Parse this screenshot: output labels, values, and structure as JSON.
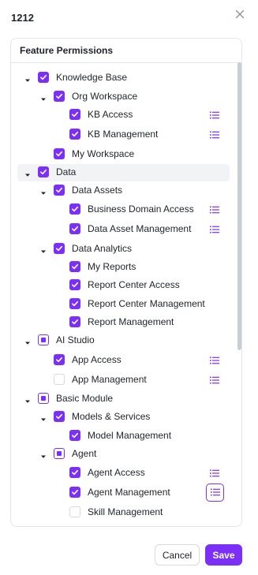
{
  "modal": {
    "title": "1212",
    "close_icon": "close-icon"
  },
  "panel": {
    "title": "Feature Permissions"
  },
  "tree": [
    {
      "label": "Knowledge Base",
      "level": 0,
      "state": "checked",
      "caret": true,
      "list": false
    },
    {
      "label": "Org Workspace",
      "level": 1,
      "state": "checked",
      "caret": true,
      "list": false
    },
    {
      "label": "KB Access",
      "level": 2,
      "state": "checked",
      "caret": false,
      "list": true
    },
    {
      "label": "KB Management",
      "level": 2,
      "state": "checked",
      "caret": false,
      "list": true
    },
    {
      "label": "My Workspace",
      "level": 1,
      "state": "checked",
      "caret": false,
      "list": false
    },
    {
      "label": "Data",
      "level": 0,
      "state": "checked",
      "caret": true,
      "list": false,
      "highlight": true
    },
    {
      "label": "Data Assets",
      "level": 1,
      "state": "checked",
      "caret": true,
      "list": false
    },
    {
      "label": "Business Domain Access",
      "level": 2,
      "state": "checked",
      "caret": false,
      "list": true
    },
    {
      "label": "Data Asset Management",
      "level": 2,
      "state": "checked",
      "caret": false,
      "list": true
    },
    {
      "label": "Data Analytics",
      "level": 1,
      "state": "checked",
      "caret": true,
      "list": false
    },
    {
      "label": "My Reports",
      "level": 2,
      "state": "checked",
      "caret": false,
      "list": false
    },
    {
      "label": "Report Center Access",
      "level": 2,
      "state": "checked",
      "caret": false,
      "list": false
    },
    {
      "label": "Report Center Management",
      "level": 2,
      "state": "checked",
      "caret": false,
      "list": false
    },
    {
      "label": "Report Management",
      "level": 2,
      "state": "checked",
      "caret": false,
      "list": false
    },
    {
      "label": "AI Studio",
      "level": 0,
      "state": "partial",
      "caret": true,
      "list": false
    },
    {
      "label": "App Access",
      "level": 1,
      "state": "checked",
      "caret": false,
      "list": true
    },
    {
      "label": "App Management",
      "level": 1,
      "state": "unchecked",
      "caret": false,
      "list": true
    },
    {
      "label": "Basic Module",
      "level": 0,
      "state": "partial",
      "caret": true,
      "list": false
    },
    {
      "label": "Models & Services",
      "level": 1,
      "state": "checked",
      "caret": true,
      "list": false
    },
    {
      "label": "Model Management",
      "level": 2,
      "state": "checked",
      "caret": false,
      "list": false
    },
    {
      "label": "Agent",
      "level": 1,
      "state": "partial",
      "caret": true,
      "list": false
    },
    {
      "label": "Agent Access",
      "level": 2,
      "state": "checked",
      "caret": false,
      "list": true
    },
    {
      "label": "Agent Management",
      "level": 2,
      "state": "checked",
      "caret": false,
      "list": true,
      "list_active": true
    },
    {
      "label": "Skill Management",
      "level": 2,
      "state": "unchecked",
      "caret": false,
      "list": false
    }
  ],
  "footer": {
    "cancel_label": "Cancel",
    "save_label": "Save"
  },
  "colors": {
    "accent": "#7b2ff7",
    "border": "#e5e6eb",
    "text": "#1f2329"
  }
}
